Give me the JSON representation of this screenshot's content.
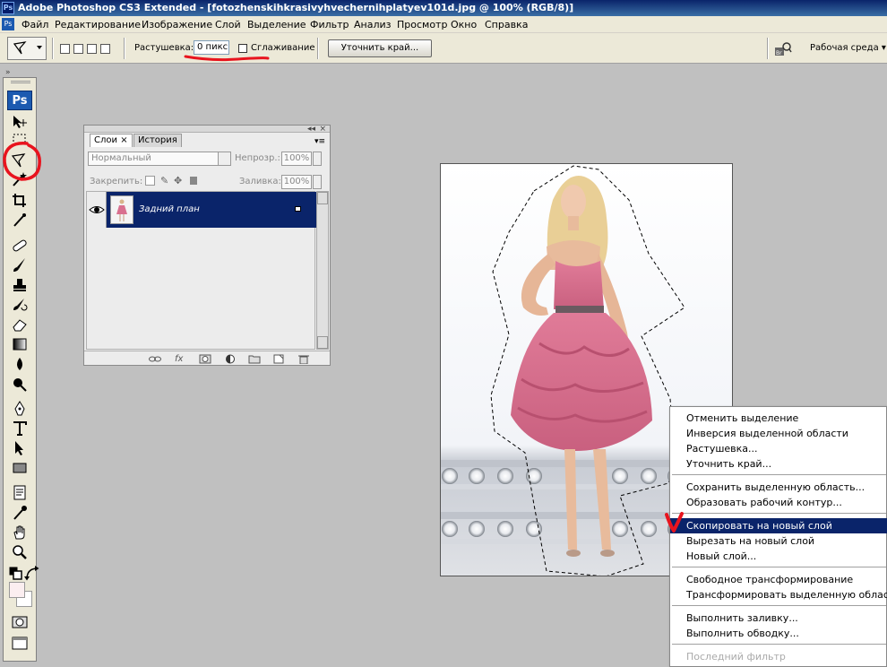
{
  "titlebar": {
    "icon": "Ps",
    "title": "Adobe Photoshop CS3 Extended - [fotozhenskihkrasivyhvechernihplatyev101d.jpg @ 100% (RGB/8)]"
  },
  "menubar": {
    "icon": "Ps",
    "items": [
      "Файл",
      "Редактирование",
      "Изображение",
      "Слой",
      "Выделение",
      "Фильтр",
      "Анализ",
      "Просмотр",
      "Окно",
      "Справка"
    ]
  },
  "options": {
    "feather_label": "Растушевка:",
    "feather_value": "0 пикс",
    "antialias_label": "Сглаживание",
    "refine_button": "Уточнить край...",
    "workspace_label": "Рабочая среда ▾",
    "bridge_icon": "bridge-icon",
    "lasso_icon": "polygonal-lasso-icon"
  },
  "toolbox": {
    "logo": "Ps",
    "tools": [
      "move-tool",
      "lasso-tool",
      "magic-wand-tool",
      "crop-tool",
      "slice-tool",
      "healing-brush-tool",
      "brush-tool",
      "clone-stamp-tool",
      "history-brush-tool",
      "eraser-tool",
      "gradient-tool",
      "blur-tool",
      "dodge-tool",
      "pen-tool",
      "type-tool",
      "path-selection-tool",
      "shape-tool",
      "notes-tool",
      "eyedropper-tool",
      "hand-tool",
      "zoom-tool"
    ],
    "foreground_color": "#fbeef0",
    "background_color": "#ffffff"
  },
  "layers_panel": {
    "tabs": [
      "Слои",
      "История"
    ],
    "active_tab_close": "×",
    "blend_mode": "Нормальный",
    "opacity_label": "Непрозр.:",
    "opacity_value": "100%",
    "lock_label": "Закрепить:",
    "fill_label": "Заливка:",
    "fill_value": "100%",
    "layers": [
      {
        "name": "Задний план",
        "visible": true,
        "locked": true
      }
    ]
  },
  "context_menu": {
    "items": [
      {
        "label": "Отменить выделение"
      },
      {
        "label": "Инверсия выделенной области"
      },
      {
        "label": "Растушевка..."
      },
      {
        "label": "Уточнить край..."
      },
      {
        "label": "Сохранить выделенную область..."
      },
      {
        "label": "Образовать рабочий контур..."
      },
      {
        "label": "Скопировать на новый слой"
      },
      {
        "label": "Вырезать на новый слой"
      },
      {
        "label": "Новый слой..."
      },
      {
        "label": "Свободное трансформирование"
      },
      {
        "label": "Трансформировать выделенную область"
      },
      {
        "label": "Выполнить заливку..."
      },
      {
        "label": "Выполнить обводку..."
      },
      {
        "label": "Последний фильтр"
      }
    ],
    "highlighted": "Скопировать на новый слой",
    "disabled": [
      "Последний фильтр"
    ]
  },
  "colors": {
    "annotation": "#e8141e",
    "highlight": "#0a246a",
    "dress": "#d9708f"
  }
}
